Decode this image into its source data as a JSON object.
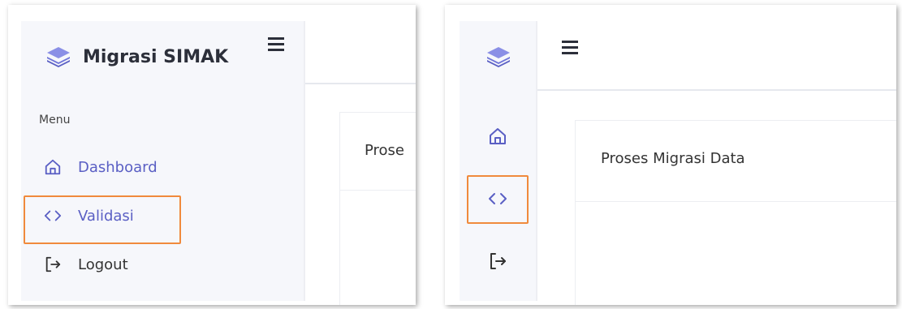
{
  "app": {
    "title": "Migrasi SIMAK",
    "brand_color": "#5a5fc4",
    "highlight_color": "#f08a3c"
  },
  "sidebar": {
    "menu_title": "Menu",
    "items": [
      {
        "label": "Dashboard",
        "icon": "home-icon",
        "active": true
      },
      {
        "label": "Validasi",
        "icon": "code-icon",
        "active": true
      },
      {
        "label": "Logout",
        "icon": "logout-icon",
        "active": false
      }
    ]
  },
  "main": {
    "card_title": "Proses Migrasi Data",
    "card_title_truncated": "Prose"
  }
}
